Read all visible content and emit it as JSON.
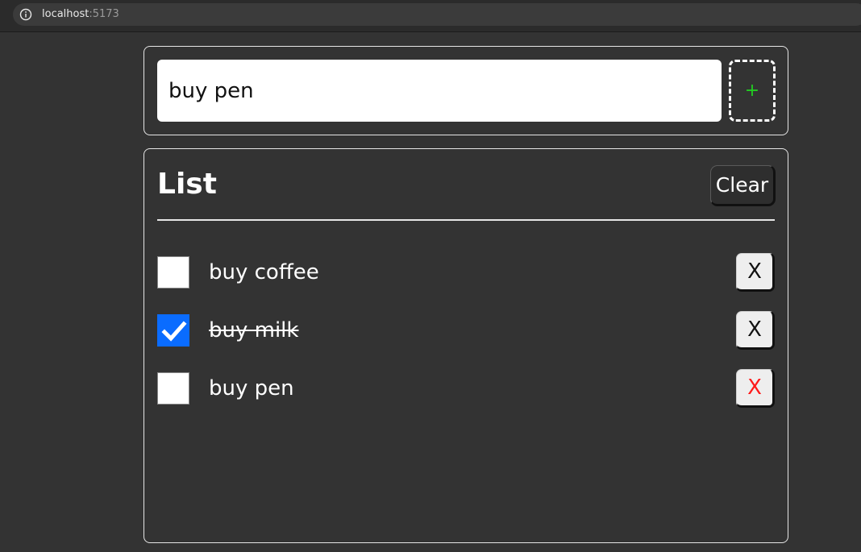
{
  "browser": {
    "url_host": "localhost",
    "url_port": ":5173",
    "icon": "info-icon"
  },
  "form": {
    "input_value": "buy pen",
    "add_label": "+",
    "add_color": "#22cc22"
  },
  "list": {
    "title": "List",
    "clear_label": "Clear",
    "items": [
      {
        "text": "buy coffee",
        "checked": false,
        "delete_label": "X"
      },
      {
        "text": "buy milk",
        "checked": true,
        "delete_label": "X"
      },
      {
        "text": "buy pen",
        "checked": false,
        "delete_label": "X",
        "delete_color": "#ff1a1a"
      }
    ]
  },
  "colors": {
    "background": "#333333",
    "checkbox_checked": "#0a6cff"
  }
}
